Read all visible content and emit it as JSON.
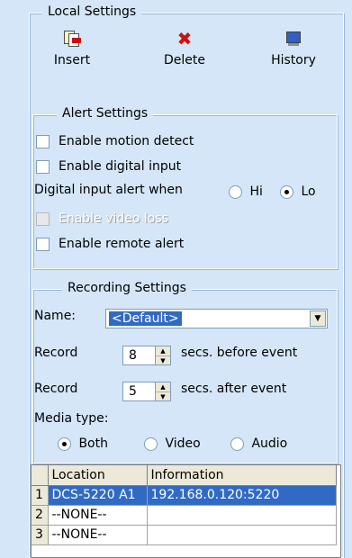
{
  "local_settings": {
    "title": "Local Settings",
    "toolbar": {
      "insert_label": "Insert",
      "delete_label": "Delete",
      "history_label": "History"
    }
  },
  "alert_settings": {
    "title": "Alert Settings",
    "enable_motion_detect": "Enable motion detect",
    "enable_digital_input": "Enable digital input",
    "digital_input_alert_when": "Digital input alert when",
    "hi_label": "Hi",
    "lo_label": "Lo",
    "selected_level": "Lo",
    "enable_video_loss": "Enable video loss",
    "enable_remote_alert": "Enable remote alert"
  },
  "recording_settings": {
    "title": "Recording Settings",
    "name_label": "Name:",
    "name_value": "<Default>",
    "record_label": "Record",
    "before_value": "8",
    "before_suffix": "secs. before event",
    "after_value": "5",
    "after_suffix": "secs. after event",
    "media_type_label": "Media type:",
    "media_options": [
      "Both",
      "Video",
      "Audio"
    ],
    "media_selected": "Both"
  },
  "grid": {
    "columns": [
      "Location",
      "Information"
    ],
    "rows": [
      {
        "num": "1",
        "location": "DCS-5220   A1",
        "information": "192.168.0.120:5220"
      },
      {
        "num": "2",
        "location": "--NONE--",
        "information": ""
      },
      {
        "num": "3",
        "location": "--NONE--",
        "information": ""
      }
    ]
  },
  "colors": {
    "panel_bg": "#d4e6f8",
    "selection": "#316ac5"
  }
}
